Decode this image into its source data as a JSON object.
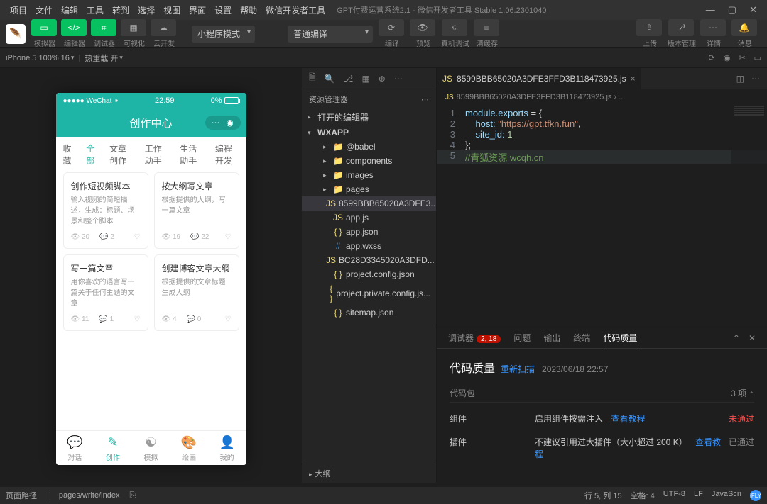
{
  "titlebar": {
    "menus": [
      "项目",
      "文件",
      "编辑",
      "工具",
      "转到",
      "选择",
      "视图",
      "界面",
      "设置",
      "帮助",
      "微信开发者工具"
    ],
    "app_title": "GPT付费运营系统2.1 - 微信开发者工具 Stable 1.06.2301040"
  },
  "toolbar": {
    "labels": [
      "模拟器",
      "编辑器",
      "调试器",
      "可视化",
      "云开发"
    ],
    "mode_select": "小程序模式",
    "compile_select": "普通编译",
    "action_labels": [
      "编译",
      "预览",
      "真机调试",
      "清缓存"
    ],
    "right_labels": [
      "上传",
      "版本管理",
      "详情",
      "消息"
    ]
  },
  "subbar": {
    "device": "iPhone 5 100% 16",
    "reload": "热重载 开"
  },
  "phone": {
    "carrier": "●●●●● WeChat",
    "wifi": "⁍",
    "time": "22:59",
    "battery": "0%",
    "header": "创作中心",
    "tabs": [
      "收藏",
      "全部",
      "文章创作",
      "工作助手",
      "生活助手",
      "编程开发"
    ],
    "cards": [
      {
        "title": "创作短视频脚本",
        "desc": "输入视频的简短描述，生成：标题、场景和整个脚本",
        "v": "20",
        "c": "2"
      },
      {
        "title": "按大纲写文章",
        "desc": "根据提供的大纲，写一篇文章",
        "v": "19",
        "c": "22"
      },
      {
        "title": "写一篇文章",
        "desc": "用你喜欢的语言写一篇关于任何主题的文章",
        "v": "11",
        "c": "1"
      },
      {
        "title": "创建博客文章大纲",
        "desc": "根据提供的文章标题生成大纲",
        "v": "4",
        "c": "0"
      }
    ],
    "nav": [
      {
        "icon": "💬",
        "label": "对话"
      },
      {
        "icon": "✎",
        "label": "创作"
      },
      {
        "icon": "☯",
        "label": "模拟"
      },
      {
        "icon": "🎨",
        "label": "绘画"
      },
      {
        "icon": "👤",
        "label": "我的"
      }
    ]
  },
  "explorer": {
    "title": "资源管理器",
    "sections": {
      "opened": "打开的编辑器",
      "root": "WXAPP",
      "outline": "大纲"
    },
    "tree": [
      {
        "t": "folder",
        "n": "@babel",
        "i": 2
      },
      {
        "t": "folder",
        "n": "components",
        "i": 2
      },
      {
        "t": "folder",
        "n": "images",
        "i": 2
      },
      {
        "t": "folder",
        "n": "pages",
        "i": 2
      },
      {
        "t": "js",
        "n": "8599BBB65020A3DFE3...",
        "i": 2,
        "sel": true
      },
      {
        "t": "js",
        "n": "app.js",
        "i": 2
      },
      {
        "t": "json",
        "n": "app.json",
        "i": 2
      },
      {
        "t": "wxss",
        "n": "app.wxss",
        "i": 2
      },
      {
        "t": "js",
        "n": "BC28D3345020A3DFD...",
        "i": 2
      },
      {
        "t": "json",
        "n": "project.config.json",
        "i": 2
      },
      {
        "t": "json",
        "n": "project.private.config.js...",
        "i": 2
      },
      {
        "t": "json",
        "n": "sitemap.json",
        "i": 2
      }
    ]
  },
  "editor": {
    "tab_name": "8599BBB65020A3DFE3FFD3B118473925.js",
    "breadcrumb": "8599BBB65020A3DFE3FFD3B118473925.js › ...",
    "code": {
      "l1a": "module",
      "l1b": ".",
      "l1c": "exports",
      "l1d": " = {",
      "l2a": "    host: ",
      "l2b": "\"https://gpt.tfkn.fun\"",
      "l2c": ",",
      "l3a": "    site_id: ",
      "l3b": "1",
      "l4": "};",
      "l5": "//青狐资源 wcqh.cn"
    }
  },
  "panel": {
    "tabs": [
      "调试器",
      "问题",
      "输出",
      "终端",
      "代码质量"
    ],
    "badge": "2, 18",
    "title": "代码质量",
    "rescan": "重新扫描",
    "time": "2023/06/18 22:57",
    "pkg_label": "代码包",
    "pkg_count": "3 项",
    "rows": [
      {
        "k": "组件",
        "v": "启用组件按需注入 ",
        "link": "查看教程",
        "s": "未通过",
        "pass": false
      },
      {
        "k": "插件",
        "v": "不建议引用过大插件（大小超过 200 K） ",
        "link": "查看教程",
        "s": "已通过",
        "pass": true
      }
    ]
  },
  "status": {
    "path_label": "页面路径",
    "path": "pages/write/index",
    "pos": "行 5, 列 15",
    "spaces": "空格: 4",
    "enc": "UTF-8",
    "eol": "LF",
    "lang": "JavaScri"
  }
}
